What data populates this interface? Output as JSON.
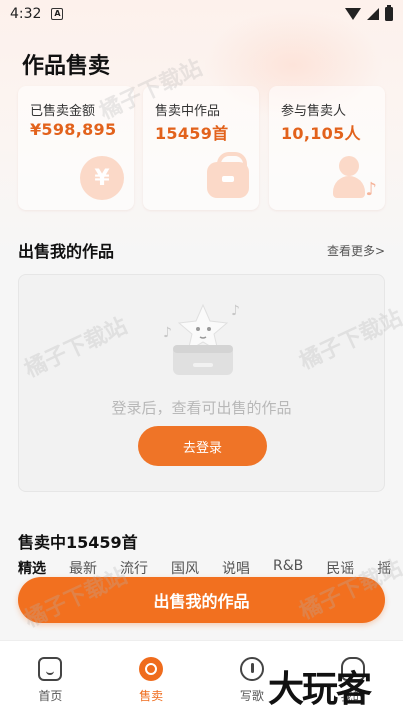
{
  "status_bar": {
    "time": "4:32",
    "notification_icon": "A"
  },
  "page_title": "作品售卖",
  "stats": [
    {
      "label": "已售卖金额",
      "value": "¥598,895",
      "icon": "yen-coin-icon"
    },
    {
      "label": "售卖中作品",
      "value": "15459首",
      "icon": "bag-icon"
    },
    {
      "label": "参与售卖人",
      "value": "10,105人",
      "icon": "person-music-icon"
    }
  ],
  "sell_my_works": {
    "title": "出售我的作品",
    "see_more": "查看更多>"
  },
  "empty_state": {
    "message": "登录后，查看可出售的作品",
    "login_button": "去登录"
  },
  "selling": {
    "title": "售卖中15459首",
    "tabs": [
      "精选",
      "最新",
      "流行",
      "国风",
      "说唱",
      "R&B",
      "民谣",
      "摇"
    ],
    "active_tab": 0
  },
  "primary_action": "出售我的作品",
  "watermark_text": "橘子下载站",
  "bottom_nav": [
    {
      "label": "首页",
      "icon": "home-icon",
      "active": false
    },
    {
      "label": "售卖",
      "icon": "sell-icon",
      "active": true
    },
    {
      "label": "写歌",
      "icon": "write-icon",
      "active": false
    },
    {
      "label": "我的",
      "icon": "mine-icon",
      "active": false
    }
  ],
  "brand_overlay": "大玩客",
  "colors": {
    "accent": "#ef7427",
    "stat_value": "#e2621c"
  }
}
